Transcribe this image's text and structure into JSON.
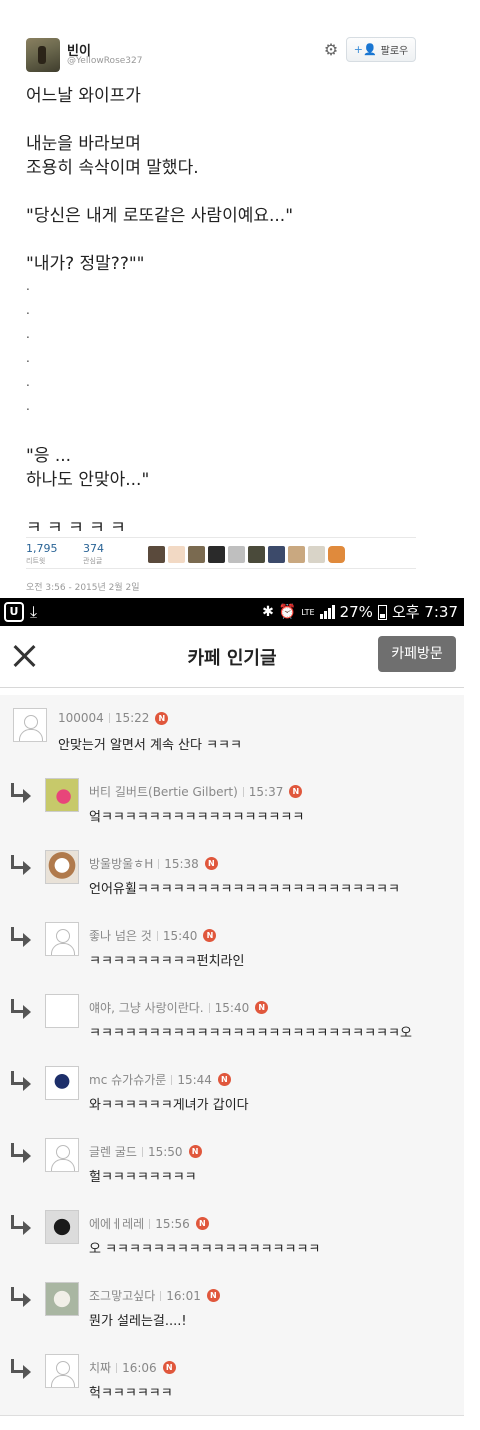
{
  "tweet": {
    "name": "빈이",
    "handle": "@YellowRose327",
    "follow_label": "팔로우",
    "lines": [
      "어느날 와이프가",
      "",
      "내눈을 바라보며",
      "조용히 속삭이며 말했다.",
      "",
      "\"당신은 내게 로또같은 사람이예요...\"",
      "",
      "\"내가? 정말??\"\"",
      ".",
      ".",
      ".",
      ".",
      ".",
      ".",
      "",
      "\"응 ...",
      "하나도 안맞아...\"",
      "",
      "ㅋ ㅋ ㅋ ㅋ ㅋ"
    ],
    "retweets": "1,795",
    "retweets_label": "리트윗",
    "favorites": "374",
    "favorites_label": "관심글",
    "date": "오전 3:56 - 2015년 2월 2일"
  },
  "statusbar": {
    "app_icon": "U",
    "network": "LTE",
    "battery": "27%",
    "time": "오후 7:37"
  },
  "cafe": {
    "title": "카페 인기글",
    "visit_label": "카페방문",
    "new_badge": "N",
    "comments": [
      {
        "user": "100004",
        "time": "15:22",
        "text": "안맞는거 알면서 계속 산다 ㅋㅋㅋ",
        "reply": false
      },
      {
        "user": "버티 길버트(Bertie Gilbert)",
        "time": "15:37",
        "text": "엌ㅋㅋㅋㅋㅋㅋㅋㅋㅋㅋㅋㅋㅋㅋㅋㅋㅋ",
        "reply": true
      },
      {
        "user": "방울방울ㅎH",
        "time": "15:38",
        "text": "언어유휠ㅋㅋㅋㅋㅋㅋㅋㅋㅋㅋㅋㅋㅋㅋㅋㅋㅋㅋㅋㅋㅋㅋ",
        "reply": true
      },
      {
        "user": "좋나 넘은 것",
        "time": "15:40",
        "text": "ㅋㅋㅋㅋㅋㅋㅋㅋㅋ펀치라인",
        "reply": true
      },
      {
        "user": "얘야, 그냥 사랑이란다.",
        "time": "15:40",
        "text": "ㅋㅋㅋㅋㅋㅋㅋㅋㅋㅋㅋㅋㅋㅋㅋㅋㅋㅋㅋㅋㅋㅋㅋㅋㅋㅋ오",
        "reply": true
      },
      {
        "user": "mc 슈가슈가룬",
        "time": "15:44",
        "text": "와ㅋㅋㅋㅋㅋㅋ게녀가 갑이다",
        "reply": true
      },
      {
        "user": "글렌 굴드",
        "time": "15:50",
        "text": "헐ㅋㅋㅋㅋㅋㅋㅋㅋ",
        "reply": true
      },
      {
        "user": "에에ㅔ레레",
        "time": "15:56",
        "text": "오 ㅋㅋㅋㅋㅋㅋㅋㅋㅋㅋㅋㅋㅋㅋㅋㅋㅋㅋ",
        "reply": true
      },
      {
        "user": "조그맣고싶다",
        "time": "16:01",
        "text": "뭔가 설레는걸....!",
        "reply": true
      },
      {
        "user": "치짜",
        "time": "16:06",
        "text": "헉ㅋㅋㅋㅋㅋㅋ",
        "reply": true
      }
    ]
  }
}
